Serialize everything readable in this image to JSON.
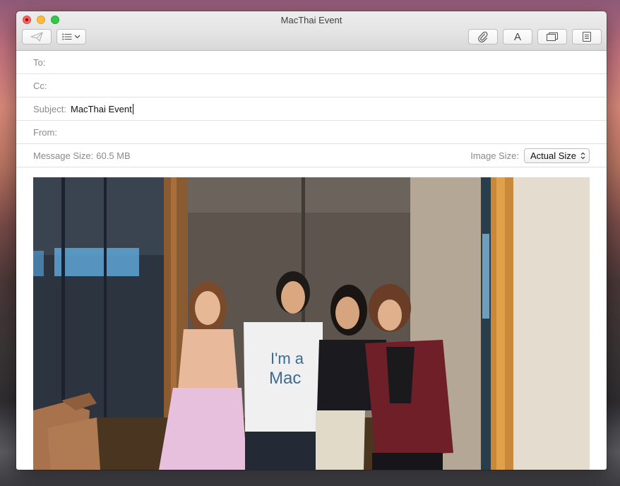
{
  "window": {
    "title": "MacThai Event"
  },
  "toolbar": {
    "send_icon": "paper-plane-icon",
    "header_fields_icon": "list-icon",
    "attach_icon": "paperclip-icon",
    "format_label": "A",
    "photo_browser_icon": "photo-browser-icon",
    "stationery_icon": "stationery-icon"
  },
  "compose": {
    "to_label": "To:",
    "to_value": "",
    "cc_label": "Cc:",
    "cc_value": "",
    "subject_label": "Subject:",
    "subject_value": "MacThai Event",
    "from_label": "From:",
    "from_value": "",
    "message_size_label": "Message Size:",
    "message_size_value": "60.5 MB",
    "image_size_label": "Image Size:",
    "image_size_value": "Actual Size"
  },
  "body": {
    "photo_shirt_text_1": "I'm a",
    "photo_shirt_text_2": "Mac"
  },
  "colors": {
    "close": "#fc605c",
    "minimize": "#fdbc40",
    "zoom": "#34c84a"
  }
}
